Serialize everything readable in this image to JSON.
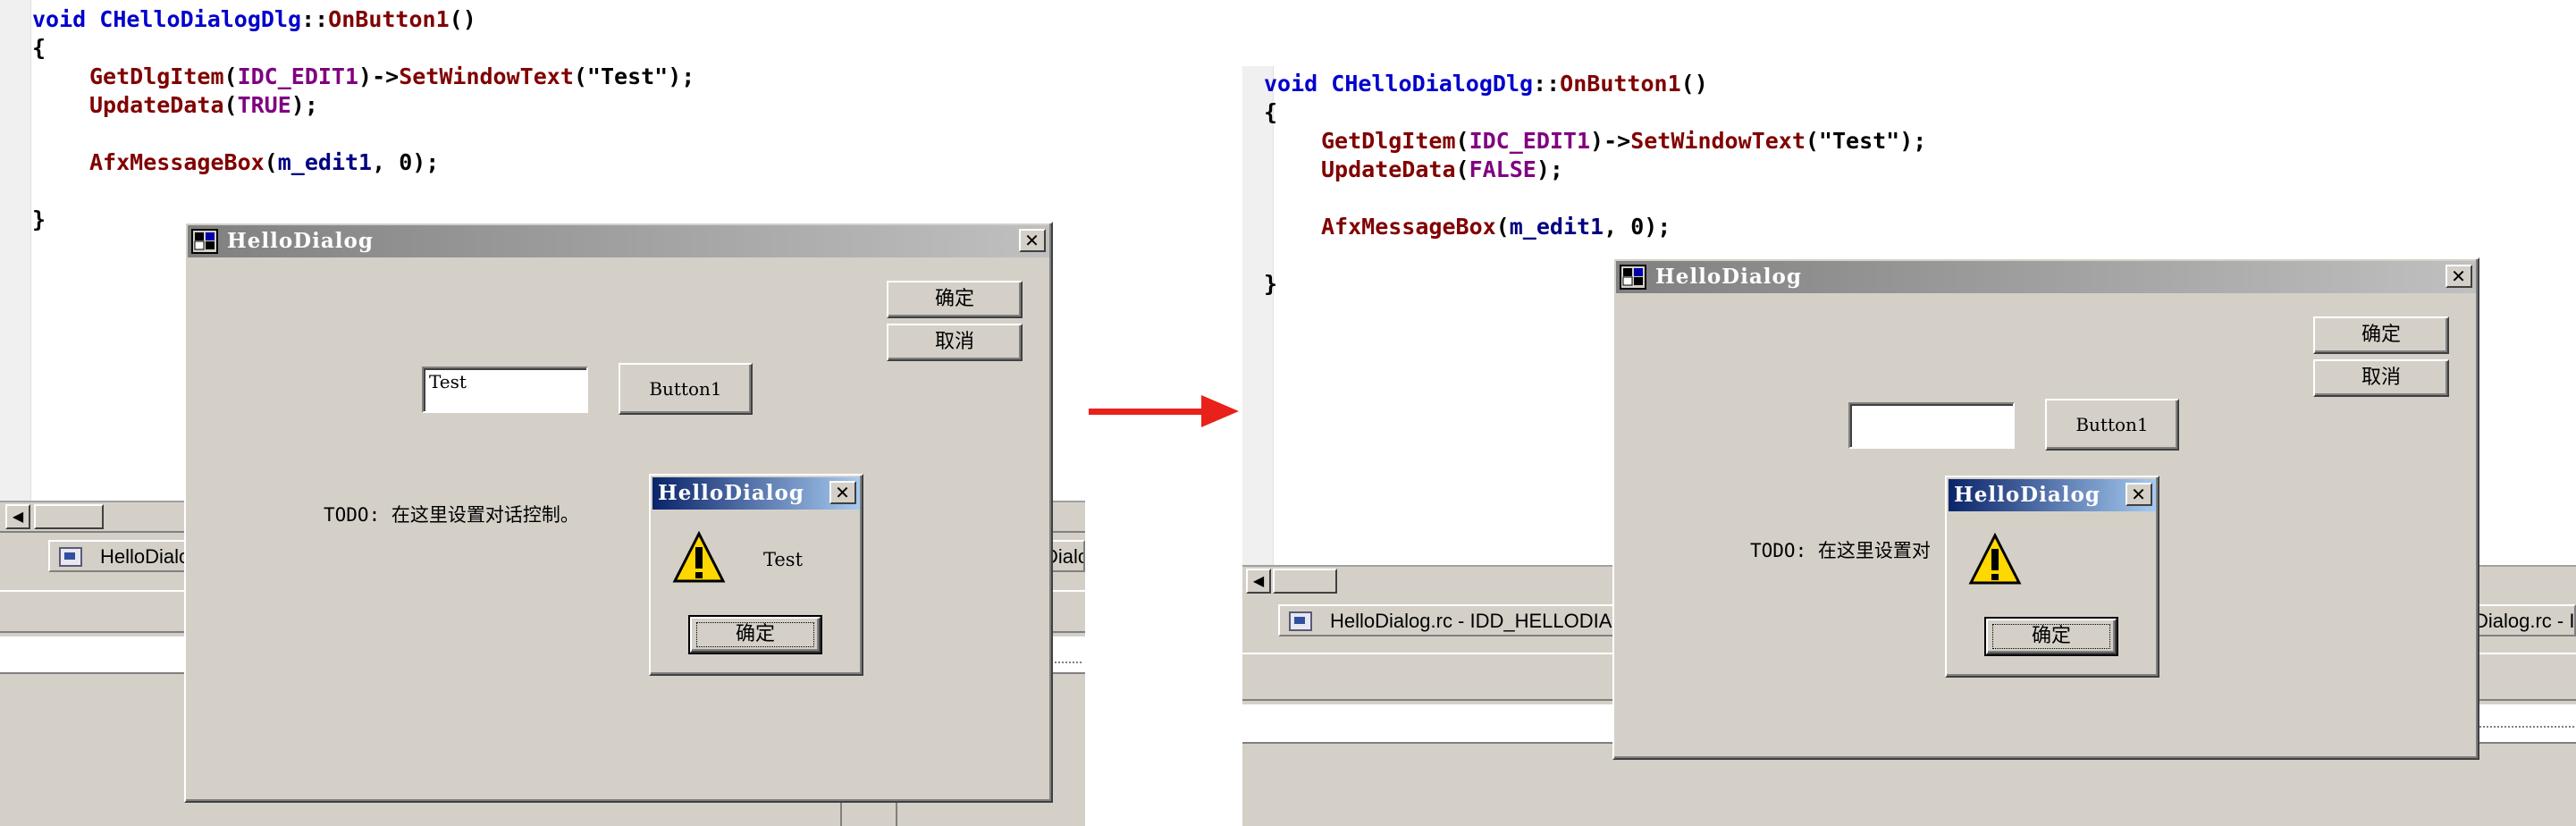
{
  "left": {
    "code": {
      "line1": {
        "kw": "void",
        "cls": "CHelloDialogDlg",
        "sep": "::",
        "fn": "OnButton1",
        "paren": "()"
      },
      "brace_open": "{",
      "line3": {
        "fn": "GetDlgItem",
        "lp": "(",
        "mac": "IDC_EDIT1",
        "rp": ")->",
        "fn2": "SetWindowText",
        "args": "(\"Test\");"
      },
      "line4": {
        "fn": "UpdateData",
        "lp": "(",
        "mac": "TRUE",
        "rp": ");"
      },
      "line6": {
        "fn": "AfxMessageBox",
        "lp": "(",
        "var": "m_edit1",
        "rest": ", 0);"
      },
      "brace_close": "}"
    },
    "dialog": {
      "title": "HelloDialog",
      "ok_label": "确定",
      "cancel_label": "取消",
      "edit_value": "Test",
      "button1_label": "Button1",
      "todo_label": "TODO: 在这里设置对话控制。"
    },
    "msgbox": {
      "title": "HelloDialog",
      "message": "Test",
      "ok_label": "确定"
    },
    "taskbar": {
      "tab_label": "HelloDialo",
      "tab_right_fragment": "Dialo"
    }
  },
  "right": {
    "code": {
      "line1": {
        "kw": "void",
        "cls": "CHelloDialogDlg",
        "sep": "::",
        "fn": "OnButton1",
        "paren": "()"
      },
      "brace_open": "{",
      "line3": {
        "fn": "GetDlgItem",
        "lp": "(",
        "mac": "IDC_EDIT1",
        "rp": ")->",
        "fn2": "SetWindowText",
        "args": "(\"Test\");"
      },
      "line4": {
        "fn": "UpdateData",
        "lp": "(",
        "mac": "FALSE",
        "rp": ");"
      },
      "line6": {
        "fn": "AfxMessageBox",
        "lp": "(",
        "var": "m_edit1",
        "rest": ", 0);"
      },
      "brace_close": "}"
    },
    "dialog": {
      "title": "HelloDialog",
      "ok_label": "确定",
      "cancel_label": "取消",
      "edit_value": "",
      "button1_label": "Button1",
      "todo_label": "TODO: 在这里设置对"
    },
    "msgbox": {
      "title": "HelloDialog",
      "message": "",
      "ok_label": "确定"
    },
    "taskbar": {
      "tab_label": "HelloDialog.rc - IDD_HELLODIAL",
      "tab_right_fragment": "Dialog.rc - ID"
    }
  },
  "colors": {
    "arrow": "#e8211b",
    "keyword": "#0000cc",
    "function": "#800000",
    "macro": "#800080",
    "variable": "#000080"
  },
  "icons": [
    "app-icon",
    "close-icon",
    "warning-icon",
    "tab-file-icon",
    "arrow-right-icon"
  ]
}
